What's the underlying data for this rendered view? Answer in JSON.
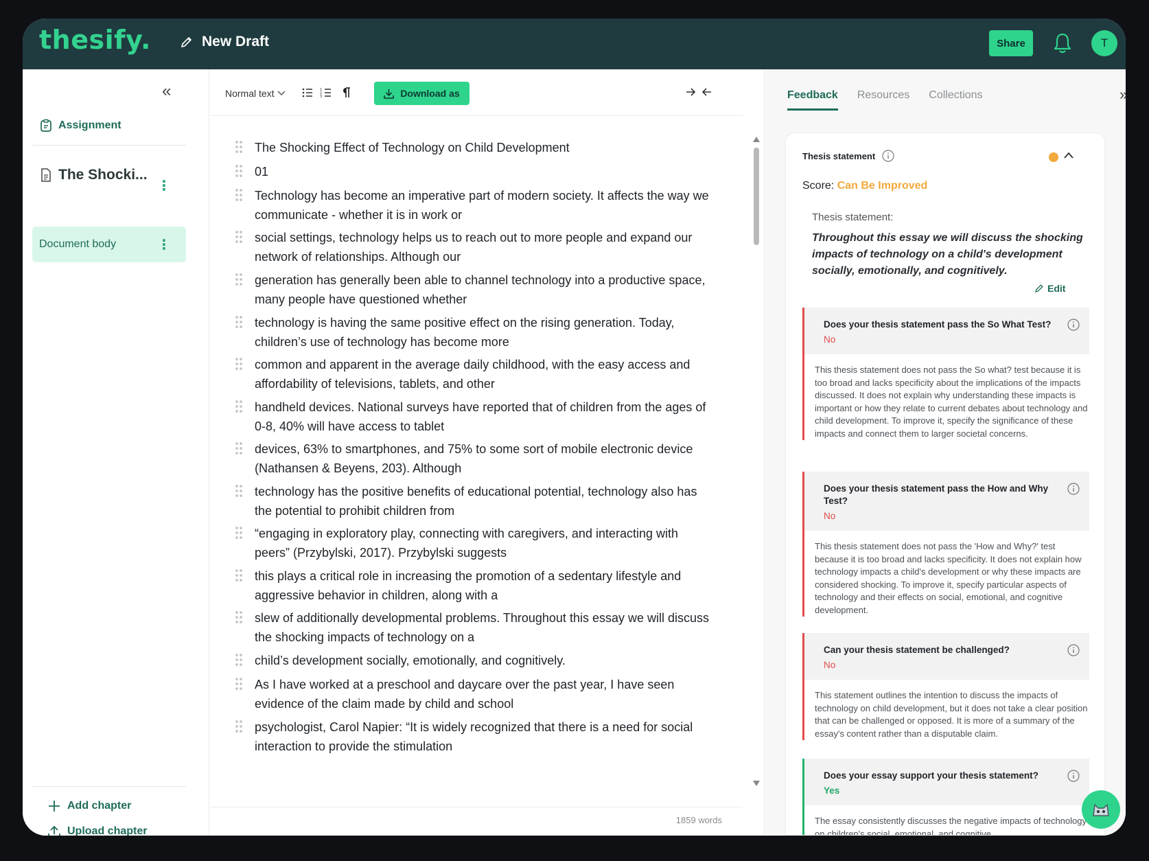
{
  "header": {
    "logo": "thesify.",
    "draft_title": "New Draft",
    "share_label": "Share",
    "avatar_initial": "T"
  },
  "sidebar": {
    "assignment_label": "Assignment",
    "chapter_title": "The Shocki...",
    "doc_body_label": "Document body",
    "add_chapter": "Add chapter",
    "upload_chapter": "Upload chapter"
  },
  "toolbar": {
    "text_style": "Normal text",
    "download_label": "Download as"
  },
  "document": {
    "paragraphs": [
      "The Shocking Effect of Technology on Child Development",
      "01",
      "Technology has become an imperative part of modern society. It affects the way we communicate - whether it is in work or",
      "social settings, technology helps us to reach out to more people and expand our network of relationships. Although our",
      "generation has generally been able to channel technology into a productive space, many people have questioned whether",
      "technology is having the same positive effect on the rising generation. Today, children’s use of technology has become more",
      "common and apparent in the average daily childhood, with the easy access and affordability of televisions, tablets, and other",
      "handheld devices. National surveys have reported that of children from the ages of 0-8, 40% will have access to tablet",
      "devices, 63% to smartphones, and 75% to some sort of mobile electronic device (Nathansen & Beyens, 203). Although",
      "technology has the positive benefits of educational potential, technology also has the potential to prohibit children from",
      "“engaging in exploratory play, connecting with caregivers, and interacting with peers” (Przybylski, 2017). Przybylski suggests",
      "this plays a critical role in increasing the promotion of a sedentary lifestyle and aggressive behavior in children, along with a",
      "slew of additionally developmental problems. Throughout this essay we will discuss the shocking impacts of technology on a",
      "child’s development socially, emotionally, and cognitively.",
      "As I have worked at a preschool and daycare over the past year, I have seen evidence of the claim made by child and school",
      "psychologist, Carol Napier: “It is widely recognized that there is a need for social interaction to provide the stimulation"
    ],
    "word_count": "1859 words"
  },
  "feedback": {
    "tabs": [
      "Feedback",
      "Resources",
      "Collections"
    ],
    "section_title": "Thesis statement",
    "score_label": "Score:",
    "score_value": "Can Be Improved",
    "thesis_label": "Thesis statement:",
    "thesis_text": "Throughout this essay we will discuss the shocking impacts of technology on a child's development socially, emotionally, and cognitively.",
    "edit_label": "Edit",
    "questions": [
      {
        "title": "Does your thesis statement pass the So What Test?",
        "answer": "No",
        "body": "This thesis statement does not pass the So what? test because it is too broad and lacks specificity about the implications of the impacts discussed. It does not explain why understanding these impacts is important or how they relate to current debates about technology and child development. To improve it, specify the significance of these impacts and connect them to larger societal concerns."
      },
      {
        "title": "Does your thesis statement pass the How and Why Test?",
        "answer": "No",
        "body": "This thesis statement does not pass the 'How and Why?' test because it is too broad and lacks specificity. It does not explain how technology impacts a child's development or why these impacts are considered shocking. To improve it, specify particular aspects of technology and their effects on social, emotional, and cognitive development."
      },
      {
        "title": "Can your thesis statement be challenged?",
        "answer": "No",
        "body": "This statement outlines the intention to discuss the impacts of technology on child development, but it does not take a clear position that can be challenged or opposed. It is more of a summary of the essay's content rather than a disputable claim."
      },
      {
        "title": "Does your essay support your thesis statement?",
        "answer": "Yes",
        "body": "The essay consistently discusses the negative impacts of technology on children's social, emotional, and cognitive"
      }
    ]
  },
  "colors": {
    "brand_green": "#2ed48c",
    "header_bg": "#1f3b3f",
    "score_orange": "#f2a93b",
    "negative_red": "#e24c4c",
    "positive_green": "#23a866"
  },
  "icons": [
    "pencil-icon",
    "bell-icon",
    "clipboard-icon",
    "document-icon",
    "plus-icon",
    "upload-icon",
    "chevron-down-icon",
    "bullet-list-icon",
    "numbered-list-icon",
    "pilcrow-icon",
    "download-icon",
    "collapse-arrows-icon",
    "info-icon",
    "chevron-up-icon",
    "drag-handle-icon",
    "chat-bot-icon"
  ]
}
